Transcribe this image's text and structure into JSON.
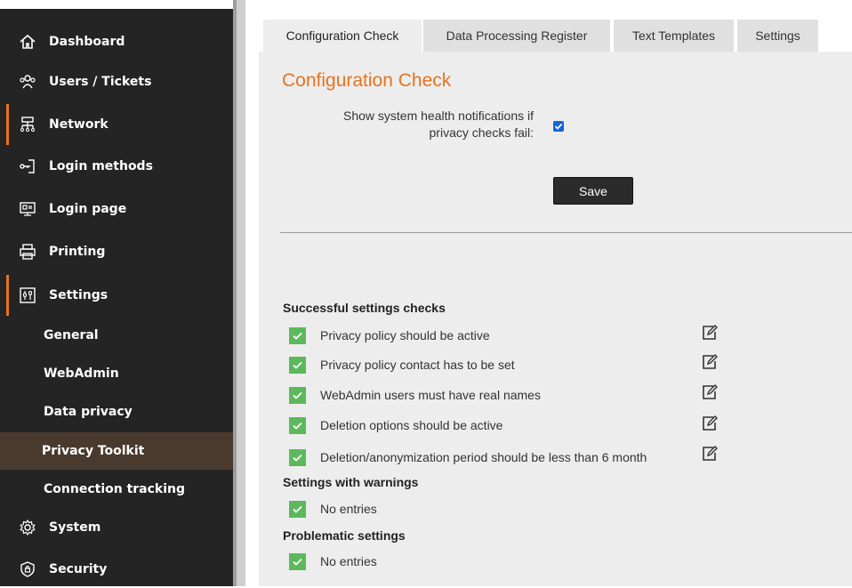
{
  "sidebar": {
    "items": [
      {
        "label": "Dashboard",
        "icon": "home-icon"
      },
      {
        "label": "Users / Tickets",
        "icon": "users-icon"
      },
      {
        "label": "Network",
        "icon": "network-icon"
      },
      {
        "label": "Login methods",
        "icon": "login-icon"
      },
      {
        "label": "Login page",
        "icon": "login-page-icon"
      },
      {
        "label": "Printing",
        "icon": "printer-icon"
      },
      {
        "label": "Settings",
        "icon": "sliders-icon"
      }
    ],
    "settings_sub": [
      {
        "label": "General"
      },
      {
        "label": "WebAdmin"
      },
      {
        "label": "Data privacy"
      },
      {
        "label": "Privacy Toolkit"
      },
      {
        "label": "Connection tracking"
      }
    ],
    "bottom_items": [
      {
        "label": "System",
        "icon": "gear-icon"
      },
      {
        "label": "Security",
        "icon": "shield-lock-icon"
      }
    ],
    "accent_color": "#e8731e"
  },
  "tabs": [
    {
      "label": "Configuration Check"
    },
    {
      "label": "Data Processing Register"
    },
    {
      "label": "Text Templates"
    },
    {
      "label": "Settings"
    }
  ],
  "main": {
    "title": "Configuration Check",
    "notify_label_line1": "Show system health notifications if",
    "notify_label_line2": "privacy checks fail:",
    "notify_checked": true,
    "save_label": "Save",
    "successful": {
      "title": "Successful settings checks",
      "items": [
        "Privacy policy should be active",
        "Privacy policy contact has to be set",
        "WebAdmin users must have real names",
        "Deletion options should be active",
        "Deletion/anonymization period should be less than 6 month"
      ]
    },
    "warnings": {
      "title": "Settings with warnings",
      "items": [
        "No entries"
      ]
    },
    "problematic": {
      "title": "Problematic settings",
      "items": [
        "No entries"
      ]
    }
  }
}
